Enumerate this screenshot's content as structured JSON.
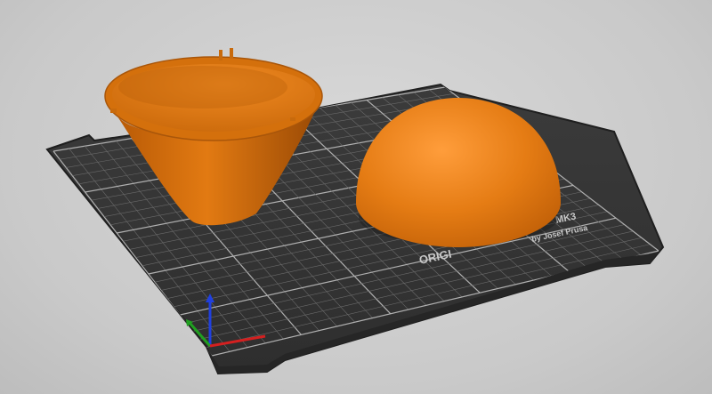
{
  "viewport": {
    "name": "3D build plate preview",
    "background_color": "#cfcfcf"
  },
  "bed": {
    "surface_color": "#3a3a3a",
    "grid_color": "#8a8a8a",
    "text_mk3": "MK3",
    "text_byline": "by Josef Prusa",
    "text_brand": "ORIGI"
  },
  "objects": [
    {
      "name": "cone-funnel",
      "color": "#e07a0f"
    },
    {
      "name": "hemisphere-dome",
      "color": "#e07a0f"
    }
  ],
  "axes": {
    "x_color": "#d42020",
    "y_color": "#20a020",
    "z_color": "#2040e0"
  }
}
